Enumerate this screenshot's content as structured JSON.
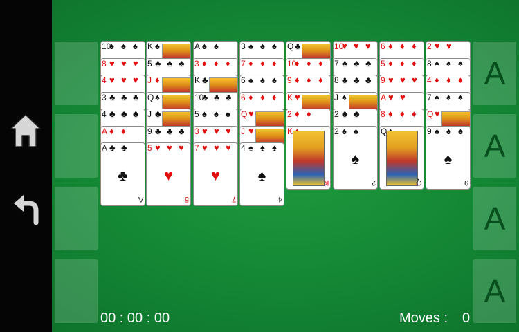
{
  "free_cells": [
    {},
    {},
    {},
    {}
  ],
  "foundations": [
    {
      "label": "A"
    },
    {
      "label": "A"
    },
    {
      "label": "A"
    },
    {
      "label": "A"
    }
  ],
  "tableau": [
    [
      {
        "rank": "10",
        "suit": "spades"
      },
      {
        "rank": "8",
        "suit": "hearts"
      },
      {
        "rank": "4",
        "suit": "hearts"
      },
      {
        "rank": "3",
        "suit": "clubs"
      },
      {
        "rank": "4",
        "suit": "clubs"
      },
      {
        "rank": "A",
        "suit": "diamonds"
      },
      {
        "rank": "A",
        "suit": "clubs"
      }
    ],
    [
      {
        "rank": "K",
        "suit": "spades"
      },
      {
        "rank": "5",
        "suit": "clubs"
      },
      {
        "rank": "J",
        "suit": "diamonds"
      },
      {
        "rank": "Q",
        "suit": "spades"
      },
      {
        "rank": "J",
        "suit": "clubs"
      },
      {
        "rank": "9",
        "suit": "clubs"
      },
      {
        "rank": "5",
        "suit": "hearts"
      }
    ],
    [
      {
        "rank": "A",
        "suit": "spades"
      },
      {
        "rank": "3",
        "suit": "diamonds"
      },
      {
        "rank": "K",
        "suit": "clubs"
      },
      {
        "rank": "10",
        "suit": "clubs"
      },
      {
        "rank": "5",
        "suit": "spades"
      },
      {
        "rank": "3",
        "suit": "hearts"
      },
      {
        "rank": "7",
        "suit": "hearts"
      }
    ],
    [
      {
        "rank": "3",
        "suit": "spades"
      },
      {
        "rank": "7",
        "suit": "diamonds"
      },
      {
        "rank": "6",
        "suit": "spades"
      },
      {
        "rank": "6",
        "suit": "diamonds"
      },
      {
        "rank": "Q",
        "suit": "hearts"
      },
      {
        "rank": "J",
        "suit": "hearts"
      },
      {
        "rank": "4",
        "suit": "spades"
      }
    ],
    [
      {
        "rank": "Q",
        "suit": "clubs"
      },
      {
        "rank": "10",
        "suit": "diamonds"
      },
      {
        "rank": "9",
        "suit": "diamonds"
      },
      {
        "rank": "K",
        "suit": "hearts"
      },
      {
        "rank": "2",
        "suit": "diamonds"
      },
      {
        "rank": "K",
        "suit": "diamonds"
      }
    ],
    [
      {
        "rank": "10",
        "suit": "hearts"
      },
      {
        "rank": "7",
        "suit": "clubs"
      },
      {
        "rank": "8",
        "suit": "clubs"
      },
      {
        "rank": "J",
        "suit": "spades"
      },
      {
        "rank": "2",
        "suit": "clubs"
      },
      {
        "rank": "2",
        "suit": "spades"
      }
    ],
    [
      {
        "rank": "6",
        "suit": "diamonds"
      },
      {
        "rank": "5",
        "suit": "diamonds"
      },
      {
        "rank": "9",
        "suit": "hearts"
      },
      {
        "rank": "A",
        "suit": "hearts"
      },
      {
        "rank": "8",
        "suit": "diamonds"
      },
      {
        "rank": "Q",
        "suit": "spades"
      }
    ],
    [
      {
        "rank": "2",
        "suit": "hearts"
      },
      {
        "rank": "8",
        "suit": "spades"
      },
      {
        "rank": "4",
        "suit": "diamonds"
      },
      {
        "rank": "7",
        "suit": "spades"
      },
      {
        "rank": "Q",
        "suit": "hearts"
      },
      {
        "rank": "9",
        "suit": "spades"
      }
    ]
  ],
  "status": {
    "timer": "00 : 00 : 00",
    "moves_label": "Moves :",
    "moves_value": "0"
  },
  "sidebar": {
    "home_icon": "home-icon",
    "undo_icon": "undo-icon"
  },
  "colors": {
    "felt": "#138534",
    "sidebar": "#050505",
    "red_suit": "#e31010",
    "black_suit": "#111111"
  }
}
